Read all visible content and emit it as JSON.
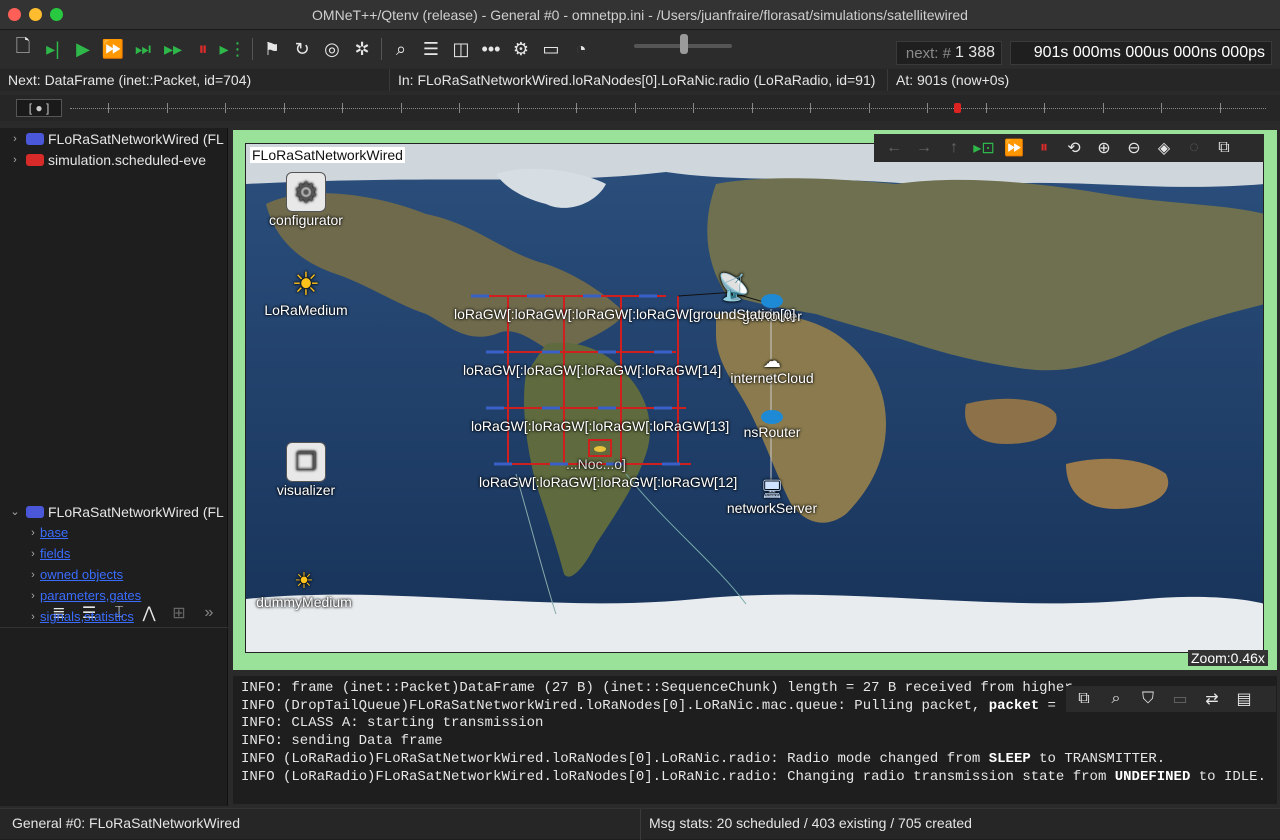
{
  "window": {
    "title": "OMNeT++/Qtenv (release) - General #0 - omnetpp.ini - /Users/juanfraire/florasat/simulations/satellitewired"
  },
  "toolbar": {
    "icons": [
      "new-run-icon",
      "run-until-icon",
      "run-icon",
      "fast-run-icon",
      "express-run-icon",
      "step-icon",
      "stop-icon",
      "run-until-marker-icon",
      "finish-icon",
      "rebuild-icon",
      "record-icon",
      "debug-icon",
      "find-icon",
      "layout-log-icon",
      "layout-split-icon",
      "timeline-icon",
      "settings-icon",
      "video-icon",
      "speed-icon"
    ],
    "next_event_label": "next: #",
    "next_event_value": "1 388",
    "sim_time": "901s 000ms 000us 000ns 000ps"
  },
  "infobar": {
    "next": "Next: DataFrame (inet::Packet, id=704)",
    "in": "In: FLoRaSatNetworkWired.loRaNodes[0].LoRaNic.radio (LoRaRadio, id=91)",
    "at": "At: 901s (now+0s)"
  },
  "timeline": {
    "range_label": "[ ● ]"
  },
  "object_tree": {
    "items": [
      {
        "label": "FLoRaSatNetworkWired (FL",
        "color": "#4a57d9"
      },
      {
        "label": "simulation.scheduled-eve",
        "color": "#d92a2a"
      }
    ]
  },
  "inspector": {
    "root": "FLoRaSatNetworkWired (FL",
    "children": [
      "base",
      "fields",
      "owned objects",
      "parameters,gates",
      "signals,statistics"
    ]
  },
  "canvas": {
    "network_name": "FLoRaSatNetworkWired",
    "zoom": "Zoom:0.46x",
    "modules": {
      "configurator": "configurator",
      "loramedium": "LoRaMedium",
      "visualizer": "visualizer",
      "dummymedium": "dummyMedium",
      "gwrouter": "gwRouter",
      "internetcloud": "internetCloud",
      "nsrouter": "nsRouter",
      "networkserver": "networkServer",
      "groundstation": "groundStation[0]",
      "row1": "loRaGW[:loRaGW[:loRaGW[:loRaGW[",
      "row2": "loRaGW[:loRaGW[:loRaGW[:loRaGW[14]",
      "row3": "loRaGW[:loRaGW[:loRaGW[:loRaGW[13]",
      "row4": "loRaGW[:loRaGW[:loRaGW[:loRaGW[12]",
      "nodes": "...Noc...o]"
    }
  },
  "log": {
    "lines": [
      {
        "prefix": "INFO: frame (inet::Packet)DataFrame (27 B) (inet::SequenceChunk) length = 27 B received from higher ",
        "bold": "",
        "suffix": ""
      },
      {
        "prefix": "INFO (DropTailQueue)FLoRaSatNetworkWired.loRaNodes[0].LoRaNic.mac.queue: Pulling packet, ",
        "bold": "packet",
        "suffix": " = (P"
      },
      {
        "prefix": "INFO: CLASS A: starting transmission",
        "bold": "",
        "suffix": ""
      },
      {
        "prefix": "INFO: sending Data frame",
        "bold": "",
        "suffix": ""
      },
      {
        "prefix": "INFO (LoRaRadio)FLoRaSatNetworkWired.loRaNodes[0].LoRaNic.radio: Radio mode changed from ",
        "bold": "SLEEP",
        "suffix": " to TRANSMITTER."
      },
      {
        "prefix": "INFO (LoRaRadio)FLoRaSatNetworkWired.loRaNodes[0].LoRaNic.radio: Changing radio transmission state from ",
        "bold": "UNDEFINED",
        "suffix": " to IDLE."
      }
    ]
  },
  "statusbar": {
    "config": "General #0: FLoRaSatNetworkWired",
    "msgstats": "Msg stats: 20 scheduled / 403 existing / 705 created"
  }
}
